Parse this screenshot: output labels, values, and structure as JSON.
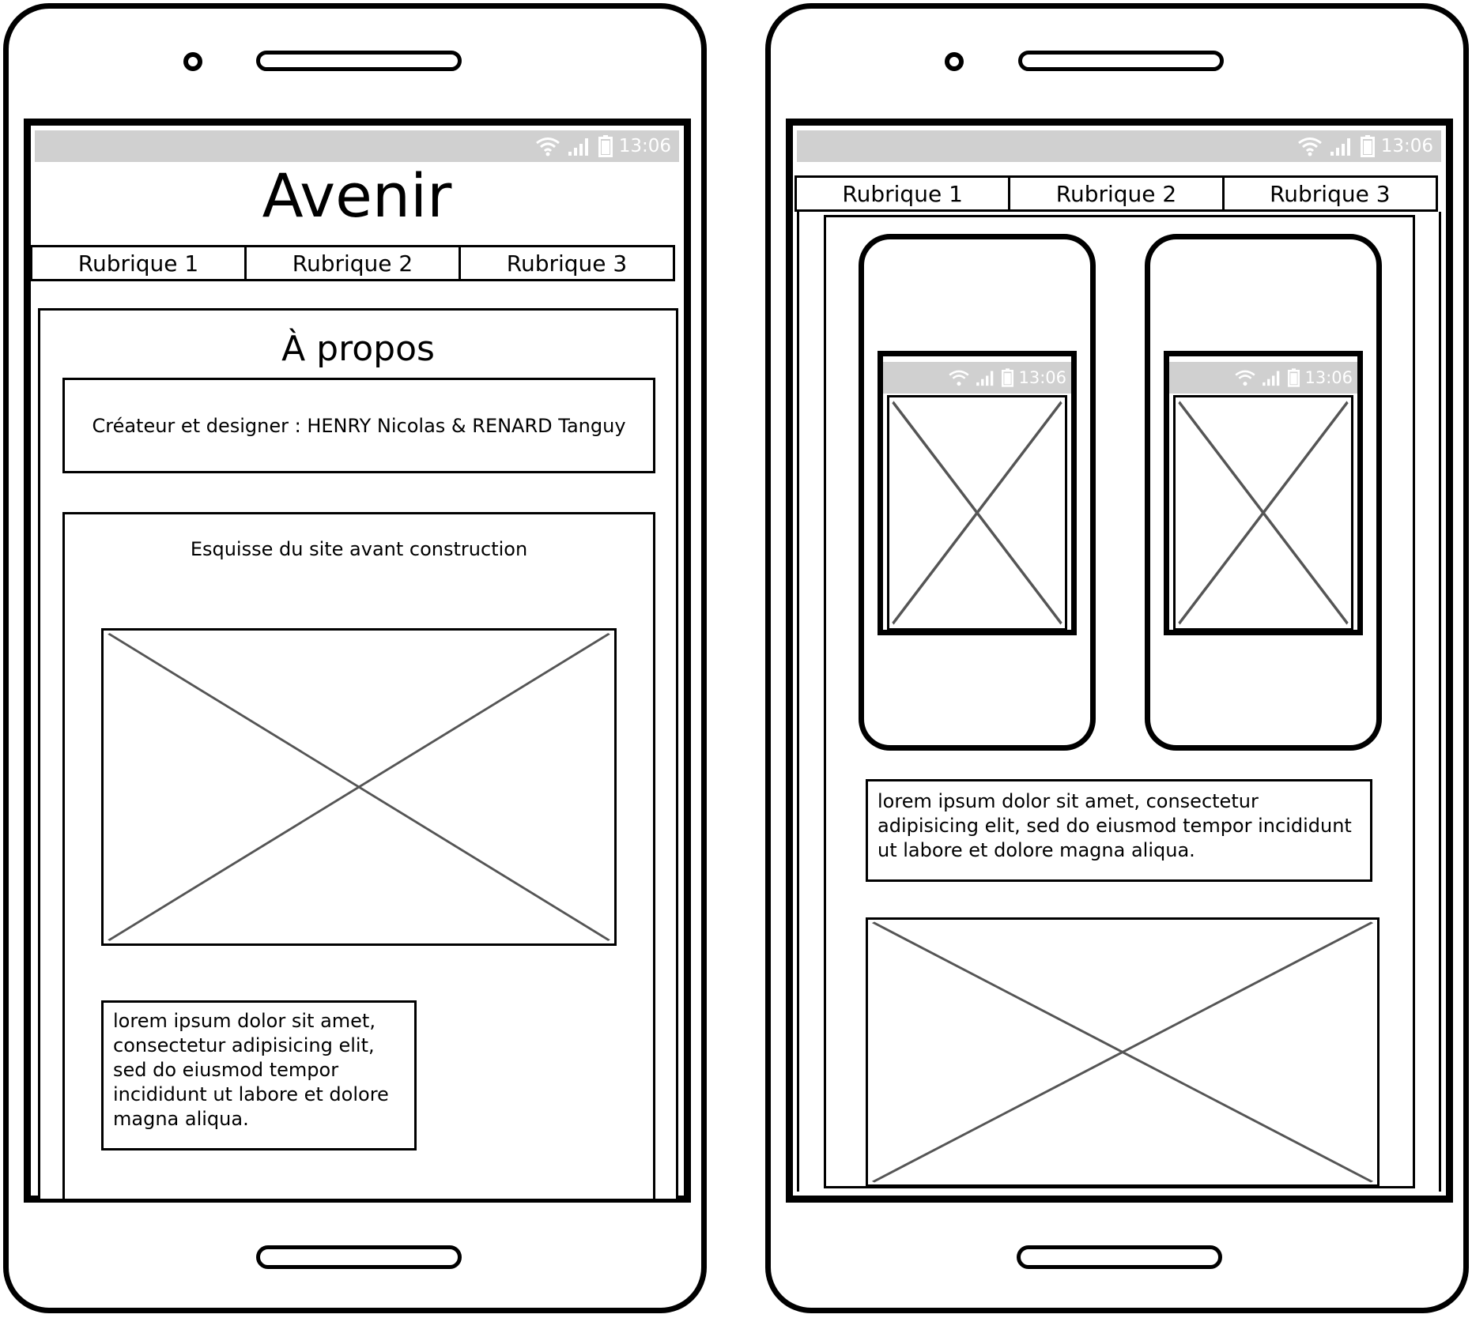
{
  "status": {
    "time": "13:06",
    "wifi_icon": "wifi-icon",
    "signal_icon": "signal-icon",
    "battery_icon": "battery-icon"
  },
  "left_phone": {
    "app_title": "Avenir",
    "tabs": [
      "Rubrique 1",
      "Rubrique 2",
      "Rubrique 3"
    ],
    "section_title": "À propos",
    "credits": "Créateur et designer : HENRY Nicolas & RENARD Tanguy",
    "sketch_caption": "Esquisse du site avant construction",
    "lorem": "lorem ipsum dolor sit amet, consectetur adipisicing elit, sed do eiusmod tempor incididunt ut labore et dolore magna aliqua."
  },
  "right_phone": {
    "tabs": [
      "Rubrique 1",
      "Rubrique 2",
      "Rubrique 3"
    ],
    "mini_time_1": "13:06",
    "mini_time_2": "13:06",
    "lorem": "lorem ipsum dolor sit amet, consectetur adipisicing elit, sed do eiusmod tempor incididunt ut labore et dolore magna aliqua."
  }
}
